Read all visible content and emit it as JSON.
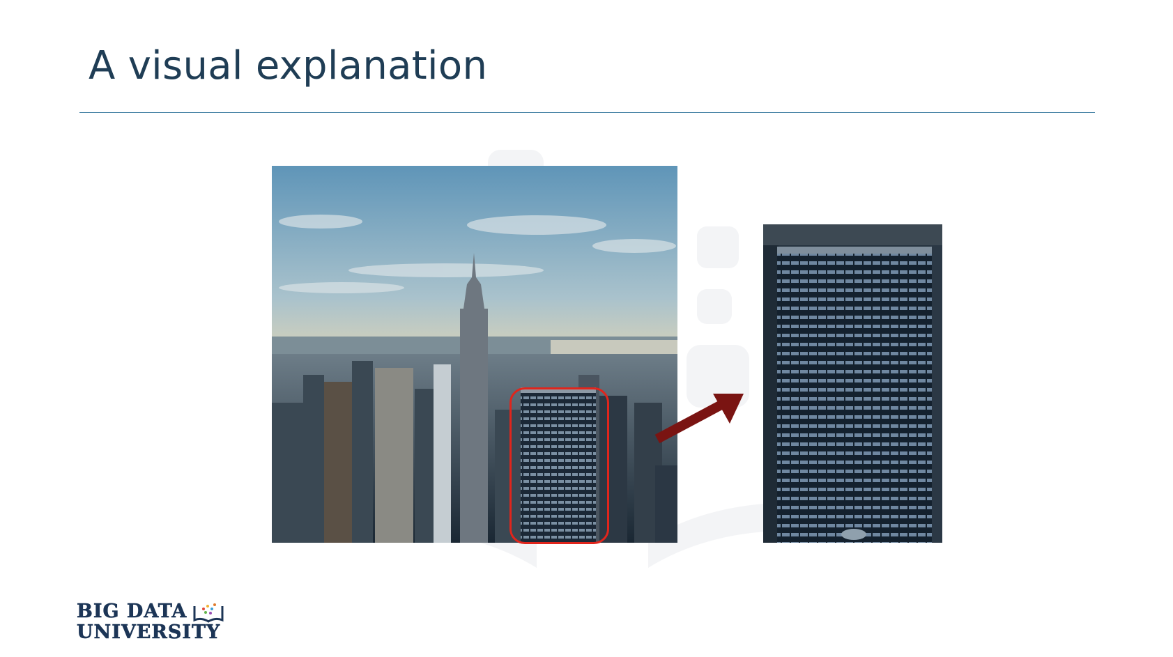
{
  "slide": {
    "title": "A visual explanation"
  },
  "images": {
    "full_city": "city-skyline-photo",
    "zoomed_building": "zoomed-building-photo"
  },
  "colors": {
    "title": "#1f3d55",
    "rule": "#4a86a8",
    "highlight": "#e0251c",
    "arrow": "#7a1412",
    "logo": "#1c3556"
  },
  "logo": {
    "line1": "BIG DATA",
    "line2": "UNIVERSITY",
    "icon": "open-book-icon"
  }
}
